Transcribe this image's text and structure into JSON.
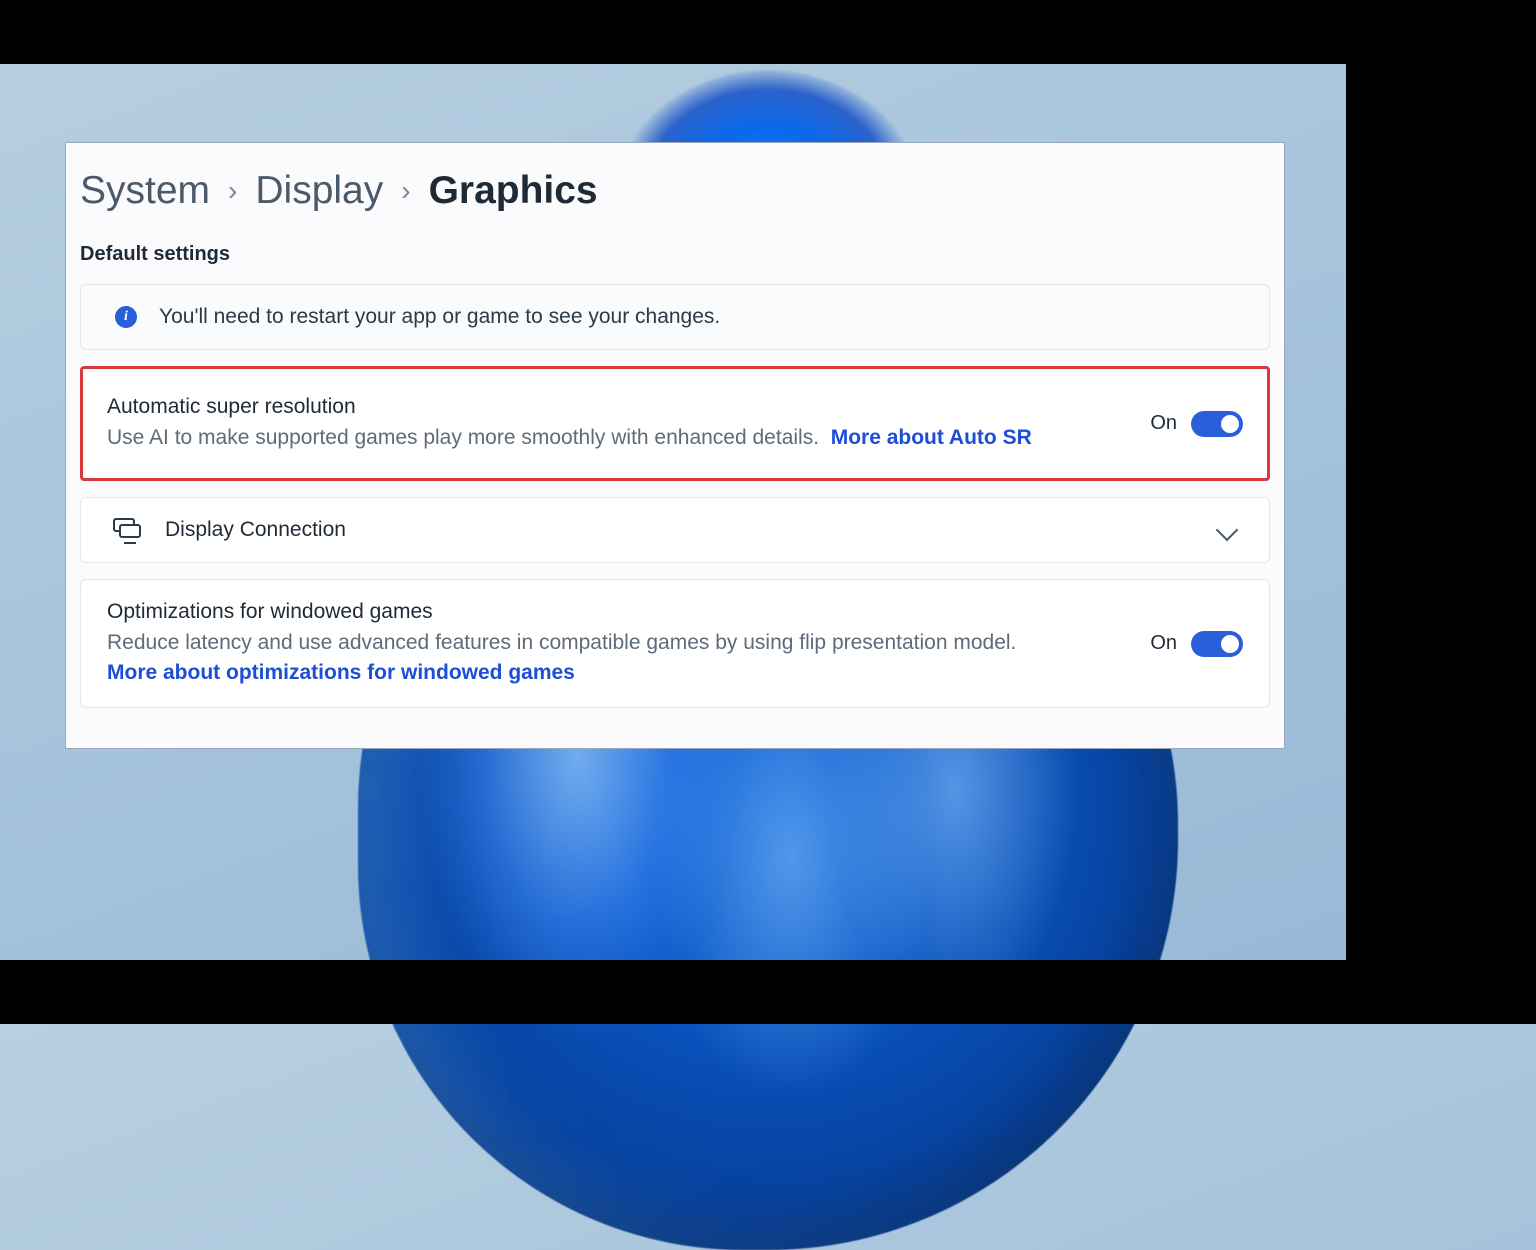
{
  "breadcrumb": {
    "level1": "System",
    "level2": "Display",
    "current": "Graphics"
  },
  "section_label": "Default settings",
  "info_banner": {
    "text": "You'll need to restart your app or game to see your changes."
  },
  "auto_sr": {
    "title": "Automatic super resolution",
    "desc": "Use AI to make supported games play more smoothly with enhanced details.",
    "link_text": "More about Auto SR",
    "state_label": "On"
  },
  "display_connection": {
    "title": "Display Connection"
  },
  "windowed_opts": {
    "title": "Optimizations for windowed games",
    "desc": "Reduce latency and use advanced features in compatible games by using flip presentation model.",
    "link_text": "More about optimizations for windowed games",
    "state_label": "On"
  }
}
